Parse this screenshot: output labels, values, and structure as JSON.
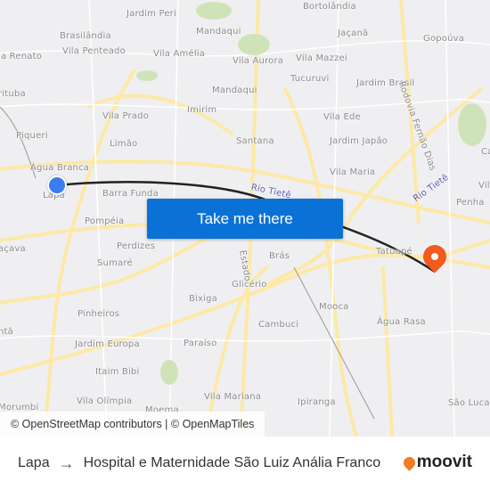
{
  "map": {
    "labels": [
      "Jardim Peri",
      "Bortolândia",
      "Brasilândia",
      "Mandaqui",
      "Jaçanã",
      "Gopoúva",
      "la Renato",
      "Vila Penteado",
      "Vila Amélia",
      "Vila Aurora",
      "Vila Mazzei",
      "Tucuruvi",
      "Jardim Brasil",
      "rituba",
      "Mandaqui",
      "Imirim",
      "Vila Prado",
      "Vila Ede",
      "Piqueri",
      "Limão",
      "Santana",
      "Jardim Japão",
      "Água Branca",
      "Vila Maria",
      "Lapa",
      "Barra Funda",
      "Vila La",
      "Penha",
      "Pompéia",
      "açava",
      "Perdizes",
      "Sumaré",
      "Brás",
      "Tatuapé",
      "Glicério",
      "Bixiga",
      "Pinheiros",
      "Mooca",
      "Cambuci",
      "Água Rasa",
      "ntã",
      "Jardim Europa",
      "Paraíso",
      "Itaim Bibi",
      "Vila Olímpia",
      "Vila Mariana",
      "Ipiranga",
      "São Luca",
      "Morumbi",
      "Moema",
      "Ca"
    ],
    "roads": [
      "Rodovia Fernão Dias",
      "Rio Tietê",
      "Rio Tietê",
      "Estado"
    ],
    "origin_color": "#3b7df0",
    "destination_color": "#f25a1f",
    "origin_icon": "origin-dot-icon",
    "destination_icon": "map-pin-icon"
  },
  "cta": {
    "label": "Take me there",
    "color": "#0a72d6"
  },
  "attribution": "© OpenStreetMap contributors | © OpenMapTiles",
  "footer": {
    "from": "Lapa",
    "arrow": "→",
    "to": "Hospital e Maternidade São Luiz Anália Franco",
    "brand": "moovit",
    "brand_color": "#f47b20"
  }
}
